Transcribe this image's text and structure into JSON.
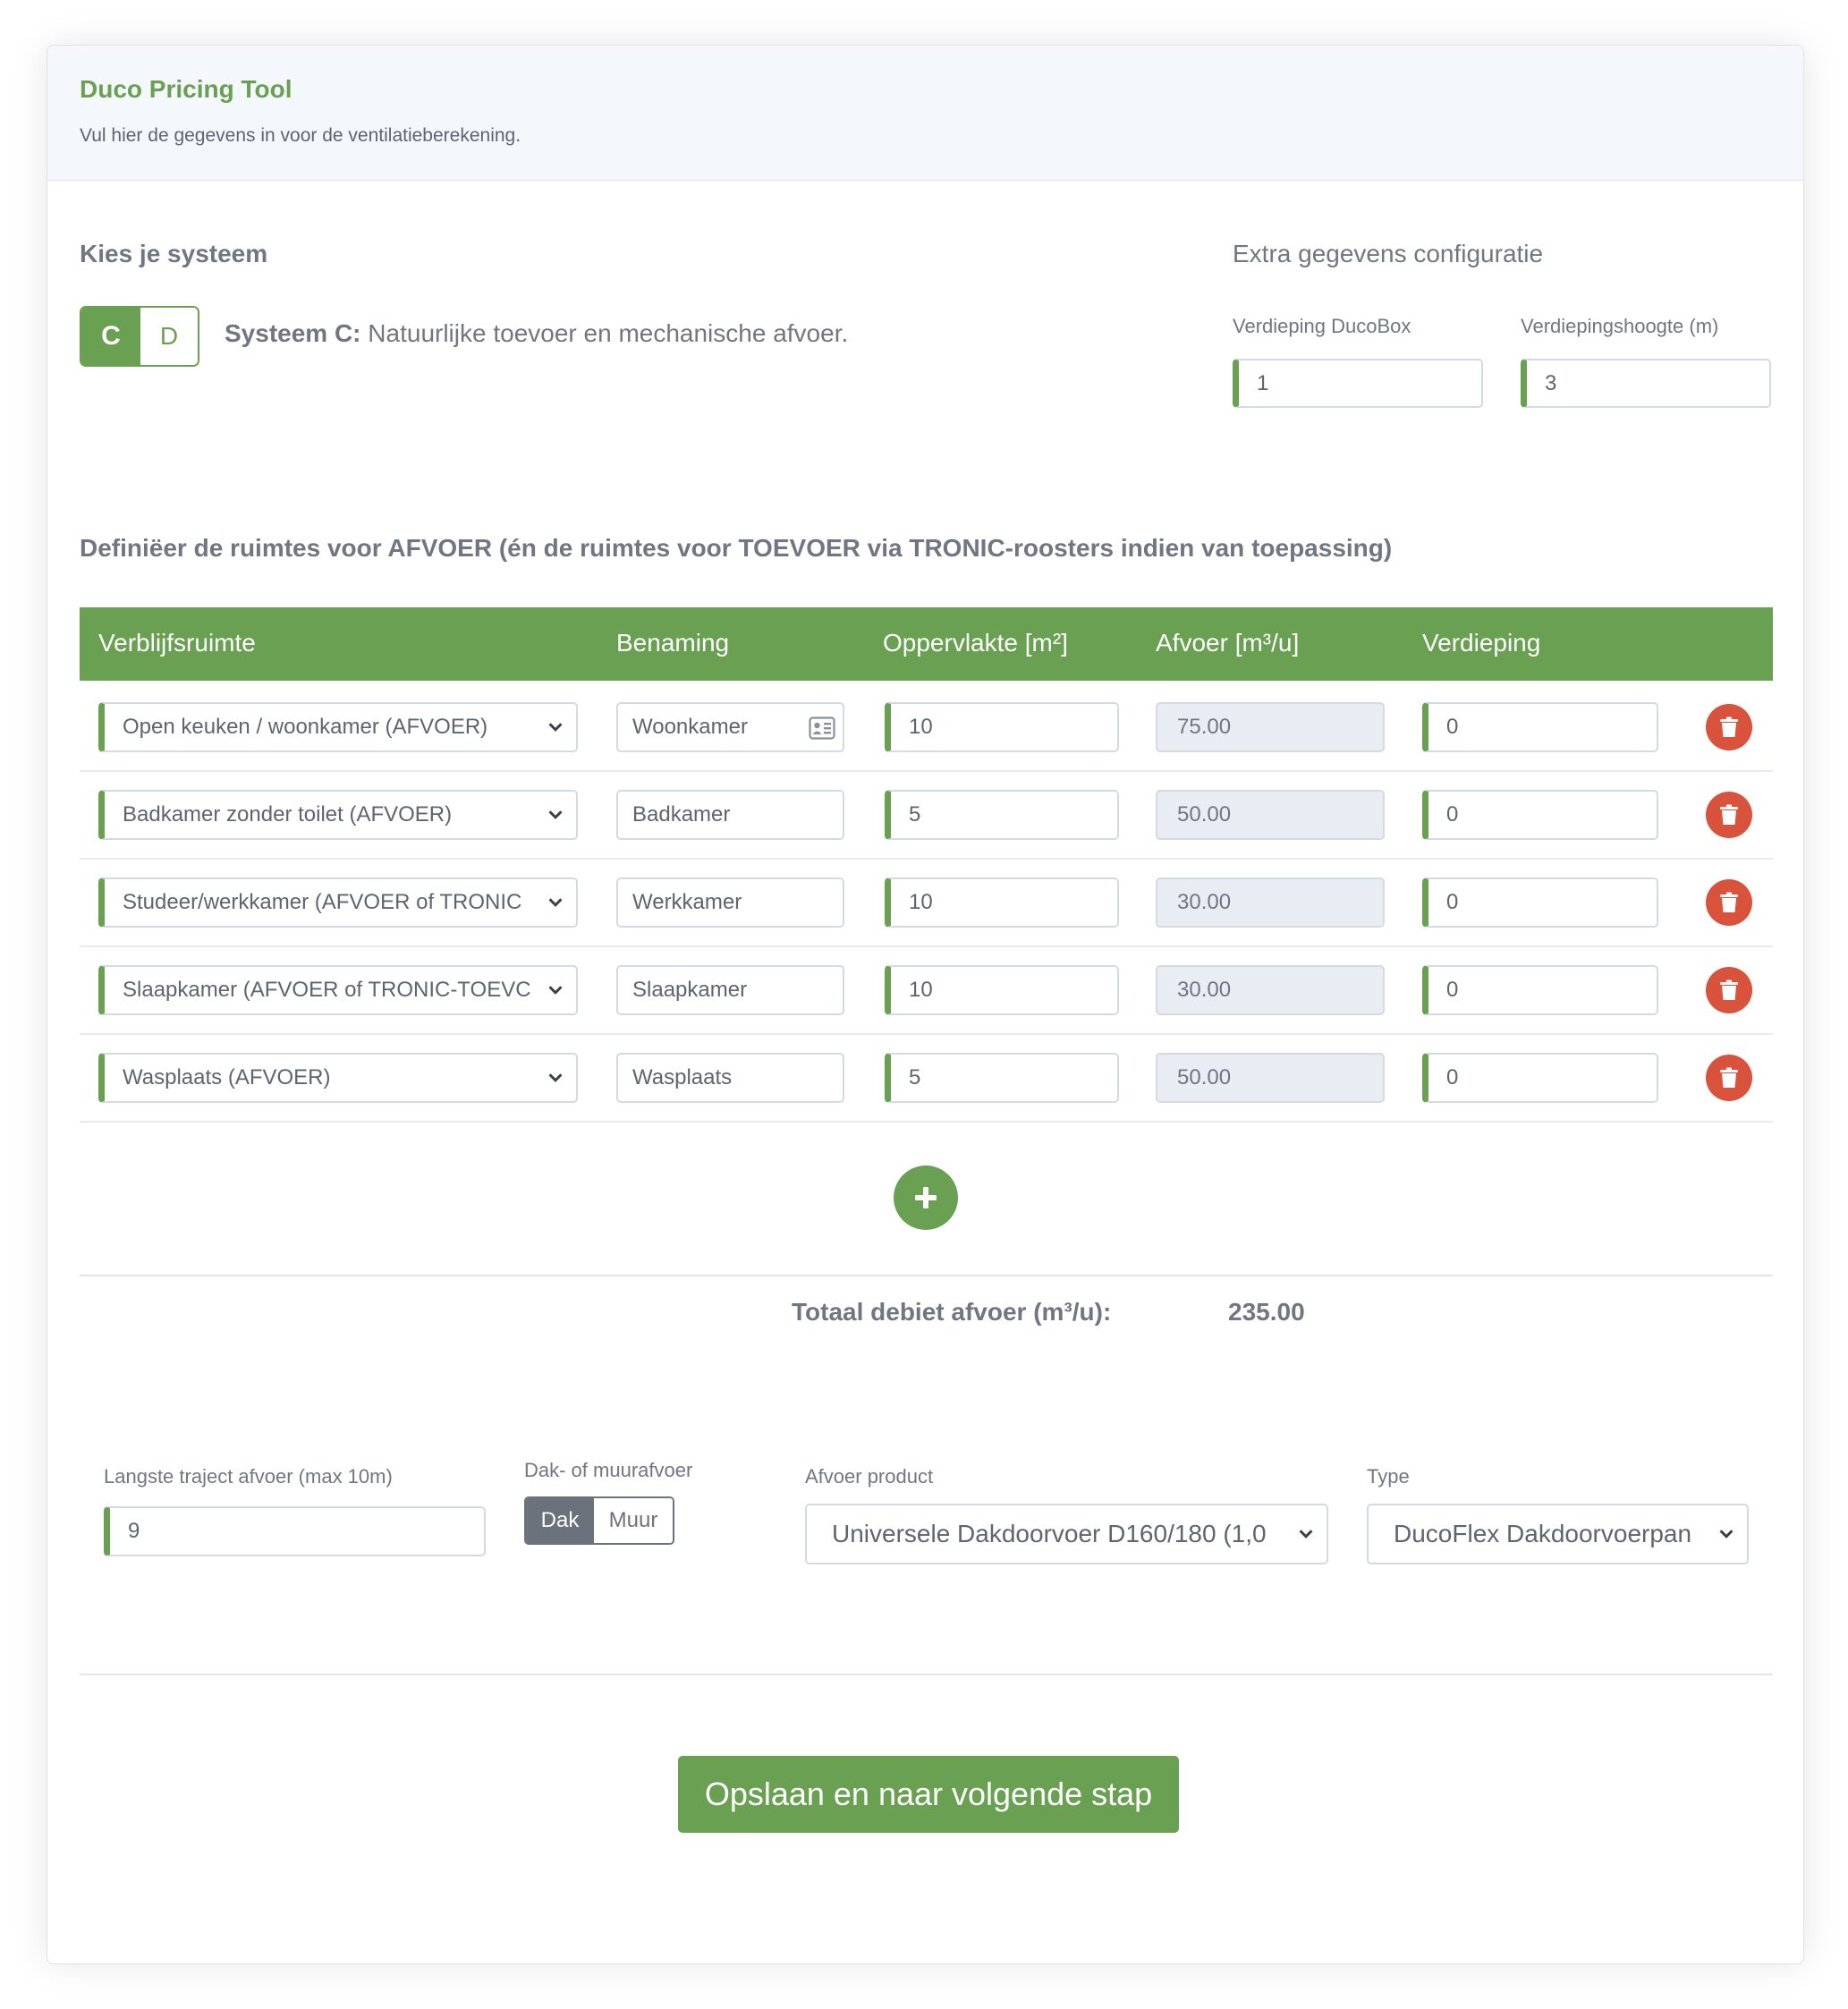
{
  "header": {
    "title": "Duco Pricing Tool",
    "subtitle": "Vul hier de gegevens in voor de ventilatieberekening."
  },
  "system": {
    "heading": "Kies je systeem",
    "options": [
      "C",
      "D"
    ],
    "selected": "C",
    "description_bold": "Systeem C:",
    "description": " Natuurlijke toevoer en mechanische afvoer."
  },
  "extra": {
    "heading": "Extra gegevens configuratie",
    "floor_label": "Verdieping DucoBox",
    "floor_value": "1",
    "height_label": "Verdiepingshoogte (m)",
    "height_value": "3"
  },
  "rooms_heading": "Definiëer de ruimtes voor AFVOER (én de ruimtes voor TOEVOER via TRONIC-roosters indien van toepassing)",
  "table": {
    "columns": [
      "Verblijfsruimte",
      "Benaming",
      "Oppervlakte [m²]",
      "Afvoer [m³/u]",
      "Verdieping"
    ],
    "rows": [
      {
        "room": "Open keuken / woonkamer (AFVOER)",
        "name": "Woonkamer",
        "area": "10",
        "exhaust": "75.00",
        "floor": "0"
      },
      {
        "room": "Badkamer zonder toilet (AFVOER)",
        "name": "Badkamer",
        "area": "5",
        "exhaust": "50.00",
        "floor": "0"
      },
      {
        "room": "Studeer/werkkamer (AFVOER of TRONIC",
        "name": "Werkkamer",
        "area": "10",
        "exhaust": "30.00",
        "floor": "0"
      },
      {
        "room": "Slaapkamer (AFVOER of TRONIC-TOEVC",
        "name": "Slaapkamer",
        "area": "10",
        "exhaust": "30.00",
        "floor": "0"
      },
      {
        "room": "Wasplaats (AFVOER)",
        "name": "Wasplaats",
        "area": "5",
        "exhaust": "50.00",
        "floor": "0"
      }
    ]
  },
  "total": {
    "label": "Totaal debiet afvoer (m³/u):",
    "value": "235.00"
  },
  "exhaust": {
    "route_label": "Langste traject afvoer (max 10m)",
    "route_value": "9",
    "mount_label": "Dak- of muurafvoer",
    "mount_options": [
      "Dak",
      "Muur"
    ],
    "mount_selected": "Dak",
    "product_label": "Afvoer product",
    "product_value": "Universele Dakdoorvoer D160/180 (1,0",
    "type_label": "Type",
    "type_value": "DucoFlex Dakdoorvoerpan"
  },
  "save_label": "Opslaan en naar volgende stap",
  "colors": {
    "accent": "#6aa052",
    "danger": "#d9533c",
    "readonly_bg": "#e9ecf2"
  }
}
